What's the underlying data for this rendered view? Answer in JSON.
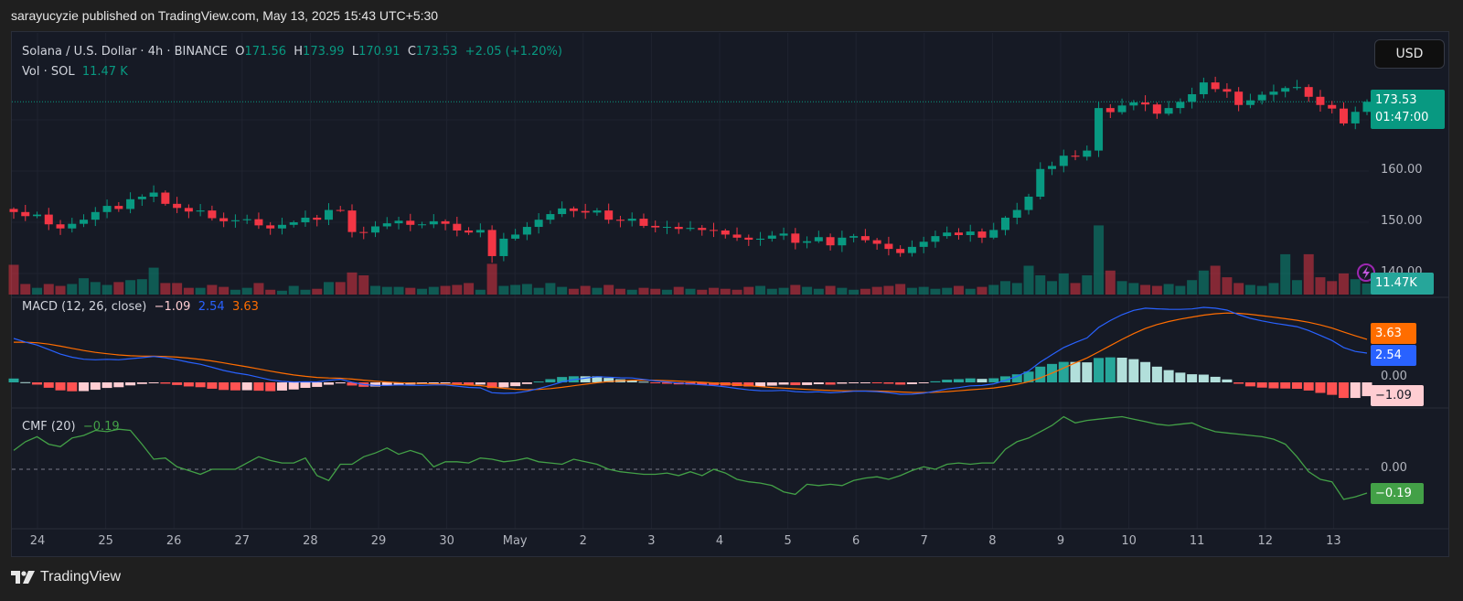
{
  "header": {
    "published": "sarayucyzie published on TradingView.com, May 13, 2025 15:43 UTC+5:30"
  },
  "legend": {
    "symbol": "Solana / U.S. Dollar · 4h · BINANCE",
    "o_label": "O",
    "open": "171.56",
    "h_label": "H",
    "high": "173.99",
    "l_label": "L",
    "low": "170.91",
    "c_label": "C",
    "close": "173.53",
    "change": "+2.05 (+1.20%)",
    "vol_label": "Vol · SOL",
    "vol_value": "11.47 K"
  },
  "macd_legend": {
    "title": "MACD (12, 26, close)",
    "hist": "−1.09",
    "macd": "2.54",
    "signal": "3.63"
  },
  "cmf_legend": {
    "title": "CMF (20)",
    "value": "−0.19"
  },
  "currency_button": "USD",
  "price_axis": {
    "labels": [
      "160.00",
      "150.00",
      "140.00"
    ],
    "last_price": "173.53",
    "countdown": "01:47:00",
    "last_volume": "11.47K"
  },
  "macd_axis": {
    "signal_tag": "3.63",
    "macd_tag": "2.54",
    "zero": "0.00",
    "hist_tag": "−1.09"
  },
  "cmf_axis": {
    "zero": "0.00",
    "value_tag": "−0.19"
  },
  "time_axis": [
    "24",
    "25",
    "26",
    "27",
    "28",
    "29",
    "30",
    "May",
    "2",
    "3",
    "4",
    "5",
    "6",
    "7",
    "8",
    "9",
    "10",
    "11",
    "12",
    "13"
  ],
  "brand": "TradingView",
  "colors": {
    "up": "#089981",
    "down": "#f23645",
    "macd": "#2962ff",
    "signal": "#ff6d00",
    "cmf": "#43a047",
    "hist_up_strong": "#26a69a",
    "hist_up_weak": "#b2dfdb",
    "hist_down_strong": "#ff5252",
    "hist_down_weak": "#ffcdd2"
  },
  "chart_data": {
    "type": "candlestick",
    "symbol": "SOLUSD",
    "interval": "4h",
    "ylim": [
      138,
      181
    ],
    "price_ticks": [
      140,
      150,
      160
    ],
    "last_ohlc": {
      "open": 171.56,
      "high": 173.99,
      "low": 170.91,
      "close": 173.53
    },
    "close": [
      152.0,
      151.2,
      151.5,
      149.6,
      148.8,
      149.7,
      150.5,
      152.0,
      153.2,
      152.6,
      154.5,
      155.0,
      155.8,
      153.6,
      152.8,
      152.1,
      152.3,
      150.8,
      150.2,
      150.4,
      150.6,
      149.4,
      148.8,
      149.5,
      150.0,
      150.9,
      150.5,
      152.4,
      152.3,
      148.1,
      148.0,
      149.2,
      149.8,
      150.3,
      149.5,
      149.6,
      150.2,
      149.7,
      148.4,
      148.0,
      148.5,
      143.4,
      146.8,
      147.6,
      149.1,
      150.5,
      151.6,
      152.7,
      152.2,
      151.9,
      152.3,
      150.5,
      150.3,
      150.7,
      149.3,
      149.0,
      149.1,
      148.7,
      148.9,
      148.5,
      148.4,
      147.6,
      147.0,
      146.6,
      146.8,
      147.4,
      147.8,
      146.0,
      146.3,
      147.1,
      145.5,
      147.0,
      147.3,
      146.5,
      145.8,
      144.8,
      144.0,
      145.2,
      146.2,
      147.3,
      148.0,
      147.5,
      148.2,
      147.0,
      148.5,
      150.9,
      152.4,
      155.0,
      160.4,
      161.0,
      163.0,
      162.8,
      164.0,
      172.3,
      171.5,
      172.8,
      173.4,
      173.0,
      171.2,
      172.3,
      173.5,
      175.0,
      177.3,
      176.0,
      175.5,
      172.9,
      173.8,
      174.9,
      175.5,
      176.2,
      176.4,
      174.5,
      172.9,
      172.2,
      169.3,
      171.56,
      173.53
    ],
    "volume_k": [
      31,
      11,
      7,
      11,
      9,
      11,
      17,
      13,
      10,
      13,
      15,
      16,
      28,
      12,
      12,
      7,
      7,
      10,
      8,
      5,
      7,
      12,
      5,
      4,
      9,
      5,
      6,
      13,
      13,
      23,
      20,
      9,
      8,
      8,
      7,
      6,
      8,
      9,
      10,
      12,
      5,
      32,
      9,
      10,
      11,
      7,
      12,
      8,
      6,
      9,
      7,
      10,
      6,
      5,
      7,
      6,
      5,
      8,
      6,
      5,
      7,
      6,
      5,
      8,
      9,
      6,
      7,
      10,
      8,
      6,
      9,
      7,
      5,
      6,
      8,
      9,
      11,
      7,
      8,
      6,
      7,
      9,
      6,
      8,
      10,
      14,
      12,
      30,
      20,
      14,
      22,
      12,
      20,
      72,
      25,
      14,
      12,
      10,
      9,
      11,
      9,
      15,
      25,
      30,
      18,
      12,
      10,
      9,
      12,
      42,
      15,
      42,
      18,
      14,
      22,
      16,
      11.47
    ],
    "macd": {
      "fast": 12,
      "slow": 26,
      "signal": 9,
      "last": {
        "macd": 2.54,
        "signal": 3.63,
        "hist": -1.09
      }
    },
    "cmf": [
      0.15,
      0.22,
      0.26,
      0.2,
      0.18,
      0.25,
      0.27,
      0.31,
      0.3,
      0.32,
      0.31,
      0.2,
      0.08,
      0.09,
      0.02,
      -0.01,
      -0.04,
      0.0,
      0.0,
      0.0,
      0.05,
      0.1,
      0.07,
      0.05,
      0.05,
      0.09,
      -0.05,
      -0.09,
      0.04,
      0.04,
      0.1,
      0.13,
      0.17,
      0.12,
      0.15,
      0.12,
      0.02,
      0.06,
      0.06,
      0.05,
      0.09,
      0.08,
      0.06,
      0.07,
      0.09,
      0.06,
      0.05,
      0.04,
      0.08,
      0.06,
      0.04,
      0.0,
      -0.02,
      -0.03,
      -0.04,
      -0.04,
      -0.03,
      -0.05,
      -0.02,
      -0.05,
      0.0,
      -0.03,
      -0.08,
      -0.1,
      -0.11,
      -0.13,
      -0.18,
      -0.2,
      -0.12,
      -0.13,
      -0.12,
      -0.13,
      -0.09,
      -0.07,
      -0.06,
      -0.08,
      -0.05,
      -0.01,
      0.02,
      0.0,
      0.04,
      0.05,
      0.04,
      0.05,
      0.05,
      0.16,
      0.22,
      0.25,
      0.3,
      0.35,
      0.42,
      0.37,
      0.39,
      0.4,
      0.41,
      0.42,
      0.4,
      0.38,
      0.36,
      0.35,
      0.36,
      0.37,
      0.33,
      0.3,
      0.29,
      0.28,
      0.27,
      0.26,
      0.24,
      0.2,
      0.1,
      -0.02,
      -0.08,
      -0.1,
      -0.24,
      -0.22,
      -0.19
    ],
    "cmf_period": 20
  }
}
